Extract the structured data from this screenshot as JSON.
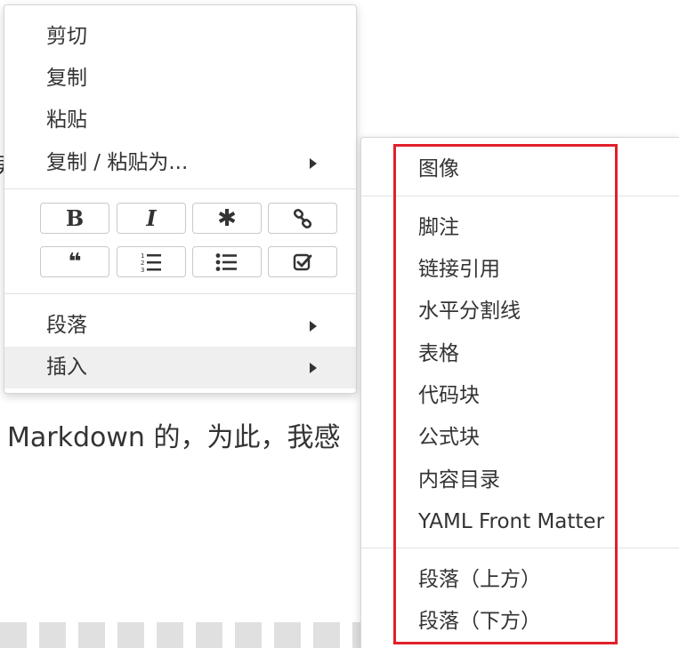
{
  "background": {
    "left_fragment": "男",
    "text_line": "Markdown 的，为此，我感"
  },
  "context_menu": {
    "items": [
      {
        "label": "剪切"
      },
      {
        "label": "复制"
      },
      {
        "label": "粘贴"
      },
      {
        "label": "复制 / 粘贴为..."
      }
    ],
    "format_buttons": [
      {
        "name": "bold",
        "glyph": "B"
      },
      {
        "name": "italic",
        "glyph": "I"
      },
      {
        "name": "code",
        "glyph": "✱"
      },
      {
        "name": "link",
        "glyph": ""
      },
      {
        "name": "quote",
        "glyph": "❝"
      },
      {
        "name": "ordered-list",
        "glyph": ""
      },
      {
        "name": "unordered-list",
        "glyph": ""
      },
      {
        "name": "task-list",
        "glyph": ""
      }
    ],
    "bottom_items": [
      {
        "label": "段落"
      },
      {
        "label": "插入"
      }
    ]
  },
  "insert_submenu": {
    "items": [
      {
        "label": "图像"
      },
      {
        "label": "脚注"
      },
      {
        "label": "链接引用"
      },
      {
        "label": "水平分割线"
      },
      {
        "label": "表格"
      },
      {
        "label": "代码块"
      },
      {
        "label": "公式块"
      },
      {
        "label": "内容目录"
      },
      {
        "label": "YAML Front Matter"
      },
      {
        "label": "段落（上方）"
      },
      {
        "label": "段落（下方）"
      }
    ]
  },
  "colors": {
    "highlight": "#e0202a",
    "active_item_bg": "#efefef",
    "menu_border": "#d6d6d6"
  }
}
